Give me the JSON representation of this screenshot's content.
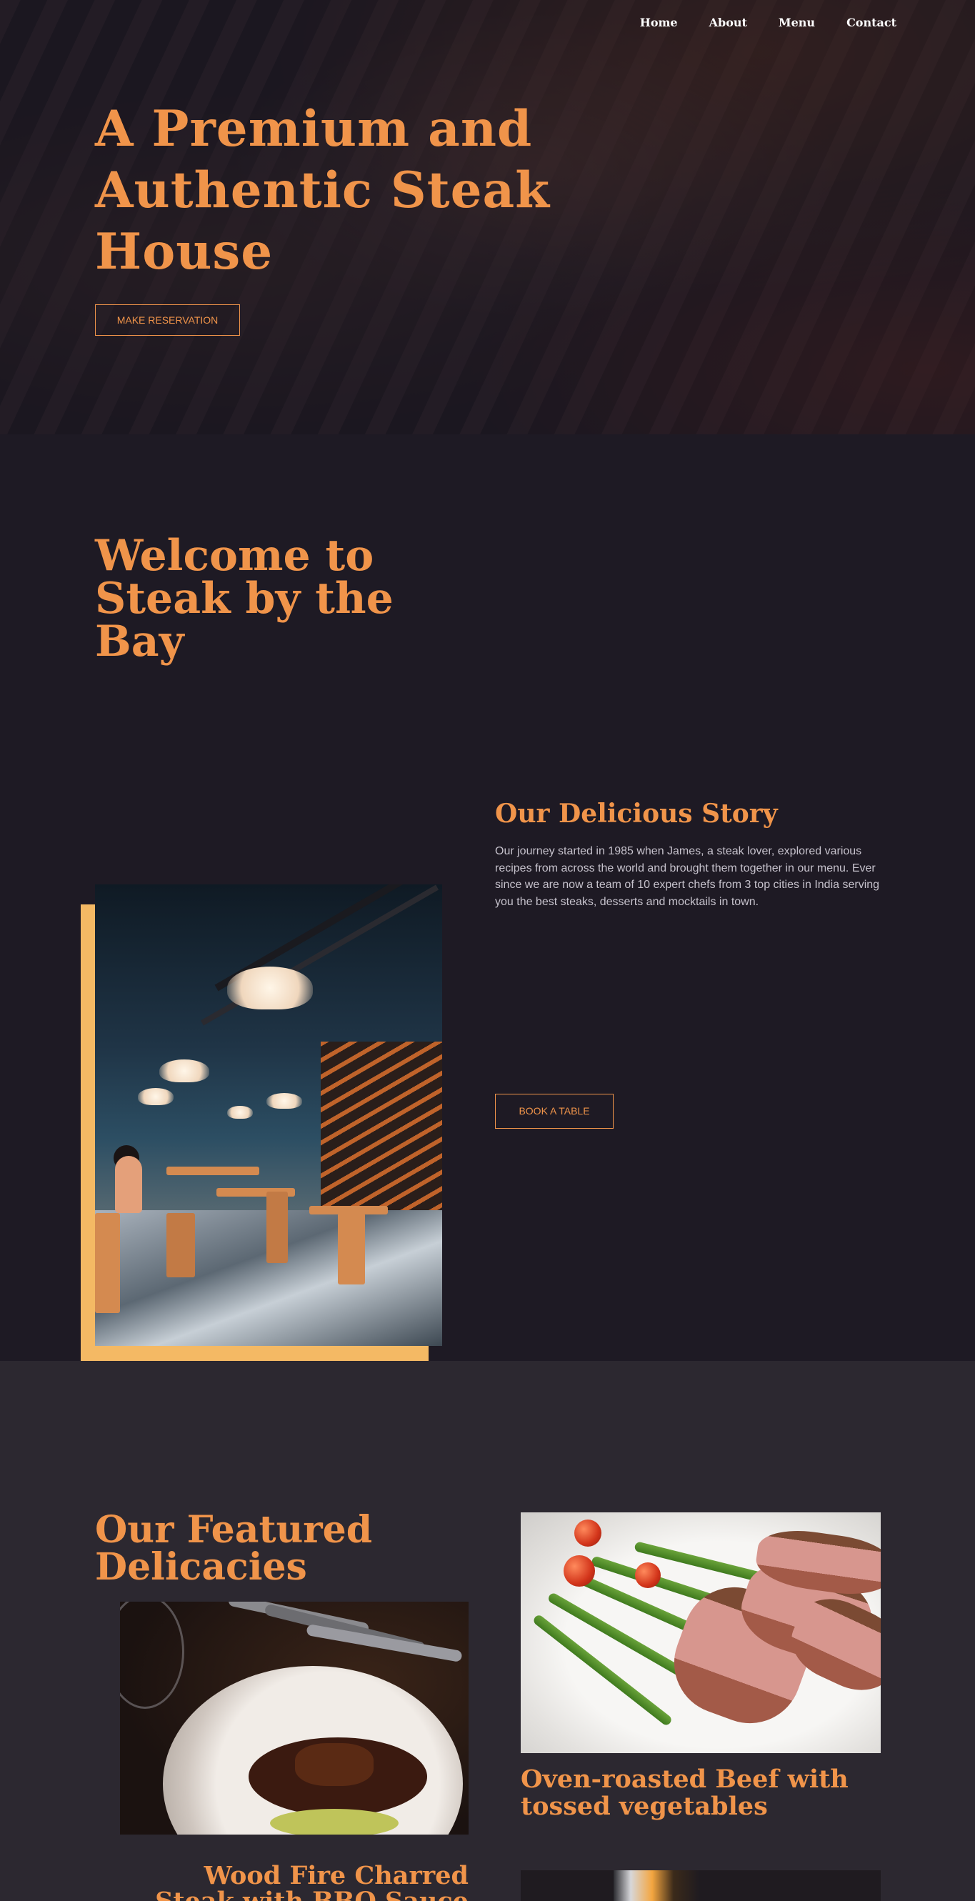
{
  "nav": {
    "items": [
      {
        "label": "Home"
      },
      {
        "label": "About"
      },
      {
        "label": "Menu"
      },
      {
        "label": "Contact"
      }
    ]
  },
  "hero": {
    "title": "A Premium and Authentic Steak House",
    "button": "MAKE RESERVATION"
  },
  "welcome": {
    "title": "Welcome to Steak by the Bay"
  },
  "story": {
    "title": "Our Delicious Story",
    "text": "Our journey started in 1985 when James, a steak lover, explored various recipes from across the world and brought them together in our menu. Ever since we are now a team of 10 expert chefs from 3 top cities in India serving you the best steaks, desserts and mocktails in town.",
    "button": "BOOK A TABLE"
  },
  "featured": {
    "title": "Our Featured Delicacies",
    "dishes": [
      {
        "title": "Wood Fire Charred Steak with BBQ Sauce"
      },
      {
        "title": "Oven-roasted Beef with tossed vegetables"
      }
    ]
  },
  "colors": {
    "accent": "#f0944a",
    "frame": "#f4b964",
    "background": "#1e1a24",
    "section": "#2c2830"
  }
}
